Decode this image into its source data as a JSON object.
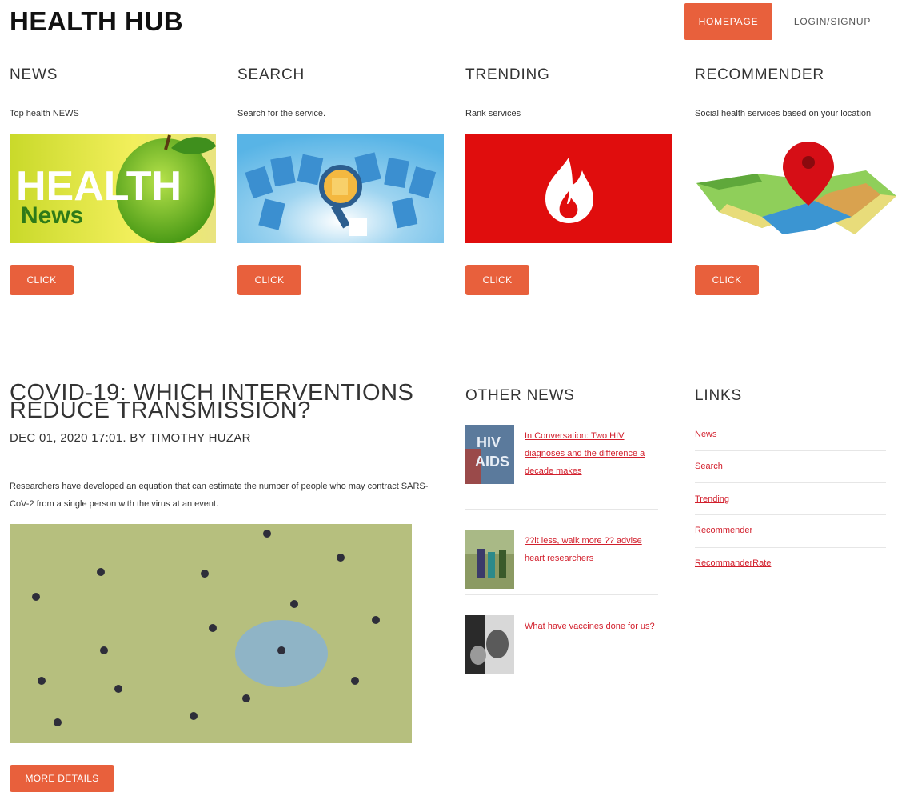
{
  "brand": "HEALTH HUB",
  "nav": {
    "home": "HOMEPAGE",
    "login": "LOGIN/SIGNUP"
  },
  "services": [
    {
      "title": "NEWS",
      "desc": "Top health NEWS",
      "button": "CLICK",
      "img_text": [
        "HEALTH",
        "News"
      ]
    },
    {
      "title": "SEARCH",
      "desc": "Search for the service.",
      "button": "CLICK"
    },
    {
      "title": "TRENDING",
      "desc": "Rank services",
      "button": "CLICK"
    },
    {
      "title": "RECOMMENDER",
      "desc": "Social health services based on your location",
      "button": "CLICK"
    }
  ],
  "article": {
    "title_line1": "COVID-19: WHICH INTERVENTIONS",
    "title_line2": "REDUCE TRANSMISSION?",
    "meta": "DEC 01, 2020 17:01. BY TIMOTHY HUZAR",
    "body": "Researchers have developed an equation that can estimate the number of people who may contract SARS-CoV-2 from a single person with the virus at an event.",
    "more_button": "MORE DETAILS"
  },
  "other_news": {
    "title": "OTHER NEWS",
    "items": [
      {
        "text": "In Conversation: Two HIV diagnoses and the difference a decade makes",
        "thumb_text": [
          "HIV",
          "AIDS"
        ]
      },
      {
        "text": "??it less, walk more ?? advise heart researchers"
      },
      {
        "text": "What have vaccines done for us?"
      }
    ]
  },
  "links": {
    "title": "LINKS",
    "items": [
      "News",
      "Search",
      "Trending",
      "Recommender",
      "RecommanderRate"
    ]
  },
  "colors": {
    "accent": "#e8603c",
    "link": "#d21f2c",
    "trending_bg": "#e00d0d"
  }
}
